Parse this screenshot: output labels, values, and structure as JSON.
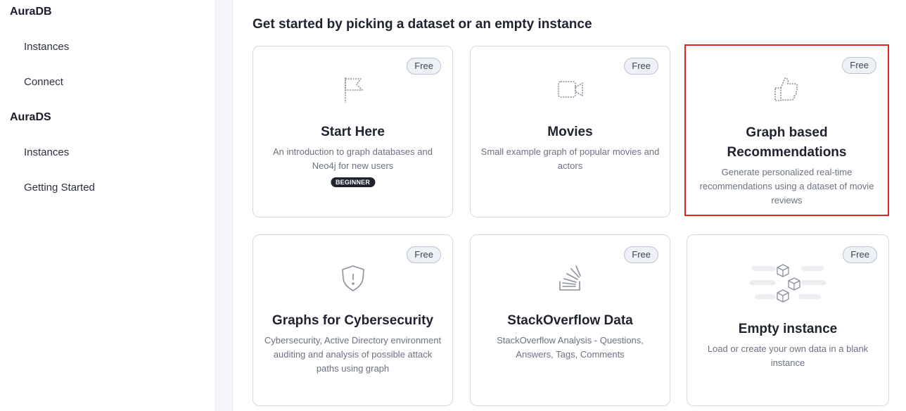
{
  "sidebar": {
    "sections": [
      {
        "title": "AuraDB",
        "items": [
          {
            "label": "Instances"
          },
          {
            "label": "Connect"
          }
        ]
      },
      {
        "title": "AuraDS",
        "items": [
          {
            "label": "Instances"
          },
          {
            "label": "Getting Started"
          }
        ]
      }
    ]
  },
  "main": {
    "title": "Get started by picking a dataset or an empty instance",
    "cards": [
      {
        "badge": "Free",
        "icon": "flag-icon",
        "title": "Start Here",
        "description": "An introduction to graph databases and Neo4j for new users",
        "tag": "BEGINNER"
      },
      {
        "badge": "Free",
        "icon": "video-camera-icon",
        "title": "Movies",
        "description": "Small example graph of popular movies and actors"
      },
      {
        "badge": "Free",
        "icon": "thumbs-up-icon",
        "title": "Graph based Recommendations",
        "description": "Generate personalized real-time recommendations using a dataset of movie reviews",
        "selected": true
      },
      {
        "badge": "Free",
        "icon": "shield-icon",
        "title": "Graphs for Cybersecurity",
        "description": "Cybersecurity, Active Directory environment auditing and analysis of possible attack paths using graph"
      },
      {
        "badge": "Free",
        "icon": "stackoverflow-icon",
        "title": "StackOverflow Data",
        "description": "StackOverflow Analysis - Questions, Answers, Tags, Comments"
      },
      {
        "badge": "Free",
        "icon": "cubes-icon",
        "title": "Empty instance",
        "description": "Load or create your own data in a blank instance"
      }
    ]
  },
  "colors": {
    "selection_border": "#e02424",
    "badge_bg": "#eef2f7",
    "tag_bg": "#1f2330"
  }
}
